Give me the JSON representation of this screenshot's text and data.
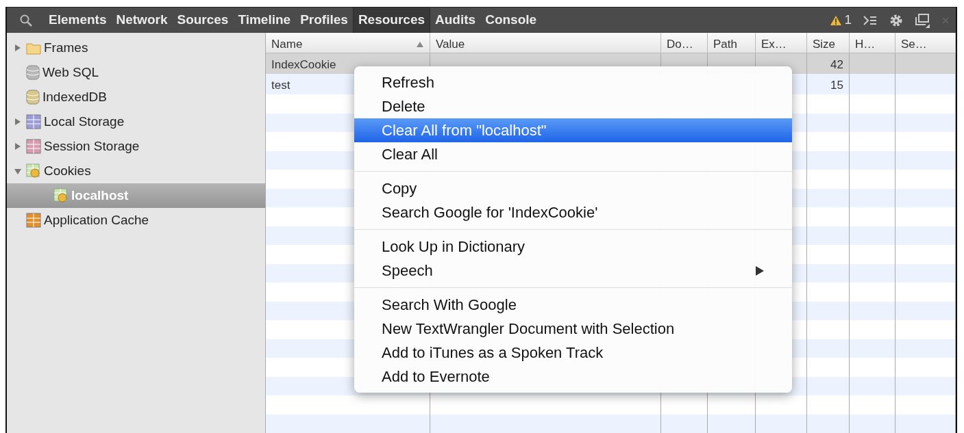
{
  "toolbar": {
    "tabs": [
      {
        "label": "Elements",
        "selected": false
      },
      {
        "label": "Network",
        "selected": false
      },
      {
        "label": "Sources",
        "selected": false
      },
      {
        "label": "Timeline",
        "selected": false
      },
      {
        "label": "Profiles",
        "selected": false
      },
      {
        "label": "Resources",
        "selected": true
      },
      {
        "label": "Audits",
        "selected": false
      },
      {
        "label": "Console",
        "selected": false
      }
    ],
    "warning_count": "1"
  },
  "sidebar": {
    "items": [
      {
        "label": "Frames",
        "kind": "folder",
        "expanded": false,
        "selected": false
      },
      {
        "label": "Web SQL",
        "kind": "database",
        "color": "#b8b8b8",
        "selected": false
      },
      {
        "label": "IndexedDB",
        "kind": "database",
        "color": "#d8c88a",
        "selected": false
      },
      {
        "label": "Local Storage",
        "kind": "grid",
        "color": "#9c9cd8",
        "expanded": false,
        "selected": false
      },
      {
        "label": "Session Storage",
        "kind": "grid",
        "color": "#d89cb0",
        "expanded": false,
        "selected": false
      },
      {
        "label": "Cookies",
        "kind": "cookies",
        "expanded": true,
        "selected": false,
        "children": [
          {
            "label": "localhost",
            "kind": "cookies",
            "selected": true
          }
        ]
      },
      {
        "label": "Application Cache",
        "kind": "grid",
        "color": "#e0902c",
        "selected": false
      }
    ]
  },
  "table": {
    "columns": [
      {
        "label": "Name",
        "sorted_ascending": true
      },
      {
        "label": "Value"
      },
      {
        "label": "Do…"
      },
      {
        "label": "Path"
      },
      {
        "label": "Ex…"
      },
      {
        "label": "Size"
      },
      {
        "label": "H…"
      },
      {
        "label": "Se…"
      }
    ],
    "rows": [
      {
        "selected": true,
        "cells": [
          "IndexCookie",
          "",
          "",
          "",
          "",
          "42",
          "",
          ""
        ]
      },
      {
        "selected": false,
        "cells": [
          "test",
          "",
          "",
          "",
          "",
          "15",
          "",
          ""
        ]
      }
    ]
  },
  "context_menu": {
    "groups": [
      [
        {
          "label": "Refresh",
          "highlighted": false
        },
        {
          "label": "Delete",
          "highlighted": false
        },
        {
          "label": "Clear All from \"localhost\"",
          "highlighted": true
        },
        {
          "label": "Clear All",
          "highlighted": false
        }
      ],
      [
        {
          "label": "Copy",
          "highlighted": false
        },
        {
          "label": "Search Google for 'IndexCookie'",
          "highlighted": false
        }
      ],
      [
        {
          "label": "Look Up in Dictionary",
          "highlighted": false
        },
        {
          "label": "Speech",
          "highlighted": false,
          "submenu": true
        }
      ],
      [
        {
          "label": "Search With Google",
          "highlighted": false
        },
        {
          "label": "New TextWrangler Document with Selection",
          "highlighted": false
        },
        {
          "label": "Add to iTunes as a Spoken Track",
          "highlighted": false
        },
        {
          "label": "Add to Evernote",
          "highlighted": false
        }
      ]
    ]
  }
}
